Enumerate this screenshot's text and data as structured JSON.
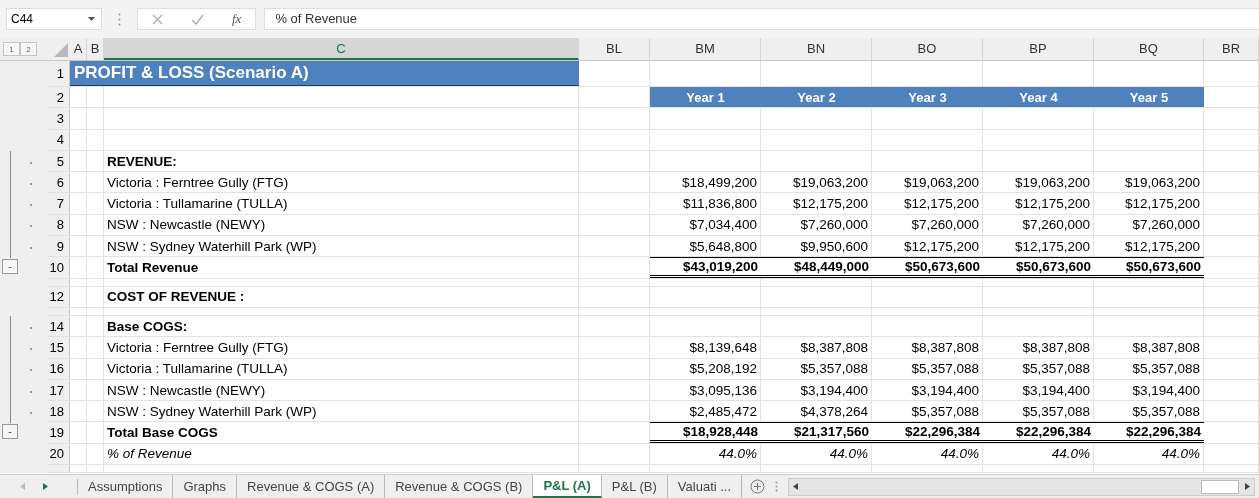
{
  "formula_bar": {
    "name_box": "C44",
    "function_label": "fx",
    "formula": "% of Revenue"
  },
  "outline_levels": [
    "1",
    "2"
  ],
  "columns": [
    {
      "letter": "A",
      "selected": false
    },
    {
      "letter": "B",
      "selected": false
    },
    {
      "letter": "C",
      "selected": true
    },
    {
      "letter": "BL",
      "selected": false
    },
    {
      "letter": "BM",
      "selected": false
    },
    {
      "letter": "BN",
      "selected": false
    },
    {
      "letter": "BO",
      "selected": false
    },
    {
      "letter": "BP",
      "selected": false
    },
    {
      "letter": "BQ",
      "selected": false
    },
    {
      "letter": "BR",
      "selected": false
    }
  ],
  "rows": [
    {
      "kind": "title",
      "number": "1",
      "label": "PROFIT & LOSS (Scenario A)"
    },
    {
      "kind": "years",
      "number": "2",
      "values": [
        "Year 1",
        "Year 2",
        "Year 3",
        "Year 4",
        "Year 5"
      ]
    },
    {
      "kind": "blank",
      "number": "3"
    },
    {
      "kind": "blank",
      "number": "4"
    },
    {
      "kind": "section",
      "number": "5",
      "grouped": true,
      "label": "REVENUE:"
    },
    {
      "kind": "item",
      "number": "6",
      "grouped": true,
      "label": "Victoria : Ferntree Gully (FTG)",
      "values": [
        "$18,499,200",
        "$19,063,200",
        "$19,063,200",
        "$19,063,200",
        "$19,063,200"
      ]
    },
    {
      "kind": "item",
      "number": "7",
      "grouped": true,
      "label": "Victoria : Tullamarine (TULLA)",
      "values": [
        "$11,836,800",
        "$12,175,200",
        "$12,175,200",
        "$12,175,200",
        "$12,175,200"
      ]
    },
    {
      "kind": "item",
      "number": "8",
      "grouped": true,
      "label": "NSW : Newcastle (NEWY)",
      "values": [
        "$7,034,400",
        "$7,260,000",
        "$7,260,000",
        "$7,260,000",
        "$7,260,000"
      ]
    },
    {
      "kind": "item",
      "number": "9",
      "grouped": true,
      "label": "NSW : Sydney Waterhill Park (WP)",
      "values": [
        "$5,648,800",
        "$9,950,600",
        "$12,175,200",
        "$12,175,200",
        "$12,175,200"
      ]
    },
    {
      "kind": "total",
      "number": "10",
      "collapse": "-",
      "label": "Total Revenue",
      "values": [
        "$43,019,200",
        "$48,449,000",
        "$50,673,600",
        "$50,673,600",
        "$50,673,600"
      ]
    },
    {
      "kind": "hidden"
    },
    {
      "kind": "section",
      "number": "12",
      "label": "COST OF REVENUE :"
    },
    {
      "kind": "hidden"
    },
    {
      "kind": "section",
      "number": "14",
      "grouped": true,
      "label": "Base COGS:"
    },
    {
      "kind": "item",
      "number": "15",
      "grouped": true,
      "label": "Victoria : Ferntree Gully (FTG)",
      "values": [
        "$8,139,648",
        "$8,387,808",
        "$8,387,808",
        "$8,387,808",
        "$8,387,808"
      ]
    },
    {
      "kind": "item",
      "number": "16",
      "grouped": true,
      "label": "Victoria : Tullamarine (TULLA)",
      "values": [
        "$5,208,192",
        "$5,357,088",
        "$5,357,088",
        "$5,357,088",
        "$5,357,088"
      ]
    },
    {
      "kind": "item",
      "number": "17",
      "grouped": true,
      "label": "NSW : Newcastle (NEWY)",
      "values": [
        "$3,095,136",
        "$3,194,400",
        "$3,194,400",
        "$3,194,400",
        "$3,194,400"
      ]
    },
    {
      "kind": "item",
      "number": "18",
      "grouped": true,
      "label": "NSW : Sydney Waterhill Park (WP)",
      "values": [
        "$2,485,472",
        "$4,378,264",
        "$5,357,088",
        "$5,357,088",
        "$5,357,088"
      ]
    },
    {
      "kind": "total",
      "number": "19",
      "collapse": "-",
      "label": "Total Base COGS",
      "values": [
        "$18,928,448",
        "$21,317,560",
        "$22,296,384",
        "$22,296,384",
        "$22,296,384"
      ]
    },
    {
      "kind": "percent",
      "number": "20",
      "label": "% of Revenue",
      "values": [
        "44.0%",
        "44.0%",
        "44.0%",
        "44.0%",
        "44.0%"
      ]
    },
    {
      "kind": "hidden"
    }
  ],
  "sheet_tabs": [
    {
      "label": "Assumptions",
      "selected": false
    },
    {
      "label": "Graphs",
      "selected": false
    },
    {
      "label": "Revenue & COGS (A)",
      "selected": false
    },
    {
      "label": "Revenue & COGS (B)",
      "selected": false
    },
    {
      "label": "P&L (A)",
      "selected": true
    },
    {
      "label": "P&L (B)",
      "selected": false
    },
    {
      "label": "Valuati ...",
      "selected": false
    }
  ]
}
